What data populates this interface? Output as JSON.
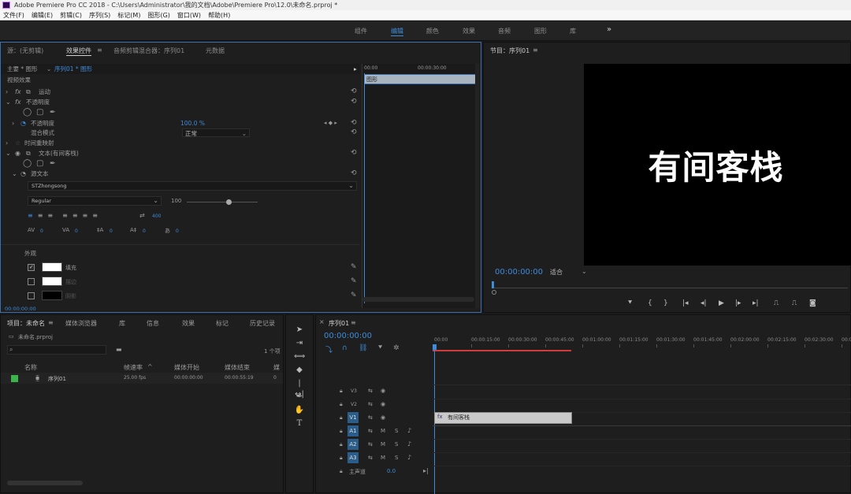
{
  "window": {
    "title": "Adobe Premiere Pro CC 2018 - C:\\Users\\Administrator\\我的文档\\Adobe\\Premiere Pro\\12.0\\未命名.prproj *"
  },
  "menu": [
    "文件(F)",
    "编辑(E)",
    "剪辑(C)",
    "序列(S)",
    "标记(M)",
    "图形(G)",
    "窗口(W)",
    "帮助(H)"
  ],
  "workspaces": [
    "组件",
    "编辑",
    "颜色",
    "效果",
    "音频",
    "图形",
    "库"
  ],
  "workspaces_more": "»",
  "effect_panel": {
    "tabs": [
      "源：(无剪辑)",
      "效果控件",
      "音频剪辑混合器：序列01",
      "元数据"
    ],
    "tab_menu": "≡",
    "master": "主要 * 图形",
    "seq": "序列01 * 图形",
    "section": "视频效果",
    "motion": "运动",
    "opacity": "不透明度",
    "opacity_prop": "不透明度",
    "opacity_value": "100.0 %",
    "blend_mode": "混合模式",
    "blend_value": "正常",
    "time_remap": "时间重映射",
    "text_layer": "文本(有间客栈)",
    "source_text": "源文本",
    "font": "STZhongsong",
    "style": "Regular",
    "font_size": "100",
    "tracking_icon_val": "400",
    "metrics": [
      "0",
      "0",
      "0",
      "0",
      "0"
    ],
    "appearance": "外观",
    "fill": "填充",
    "stroke": "描边",
    "shadow": "阴影",
    "timecode": "00:00:00:00",
    "mini_timeline": {
      "start": "00:00",
      "end": "00:00:30:00",
      "clip": "图形"
    }
  },
  "program": {
    "title": "节目：序列01",
    "tab_menu": "≡",
    "text": "有间客栈",
    "timecode": "00:00:00:00",
    "fit": "适合"
  },
  "project": {
    "tabs": [
      "项目：未命名",
      "媒体浏览器",
      "库",
      "信息",
      "效果",
      "标记",
      "历史记录"
    ],
    "tab_menu": "≡",
    "file": "未命名.prproj",
    "count": "1 个项",
    "columns": [
      "名称",
      "帧速率",
      "媒体开始",
      "媒体结束",
      "媒"
    ],
    "items": [
      {
        "name": "序列01",
        "fps": "25.00 fps",
        "start": "00:00:00:00",
        "end": "00:00:55:19",
        "more": "0"
      }
    ]
  },
  "timeline": {
    "title": "序列01",
    "tab_menu": "≡",
    "timecode": "00:00:00:00",
    "ruler": [
      "00:00",
      "00:00:15:00",
      "00:00:30:00",
      "00:00:45:00",
      "00:01:00:00",
      "00:01:15:00",
      "00:01:30:00",
      "00:01:45:00",
      "00:02:00:00",
      "00:02:15:00",
      "00:02:30:00",
      "00:02:45:00"
    ],
    "video_tracks": [
      "V3",
      "V2",
      "V1"
    ],
    "audio_tracks": [
      "A1",
      "A2",
      "A3"
    ],
    "master": "主声道",
    "master_val": "0.0",
    "clip": "有间客栈",
    "m_label": "M",
    "s_label": "S"
  },
  "colors": {
    "accent": "#3d8bd9",
    "fill": "#ffffff",
    "shadow": "#000000",
    "clip": "#c9c9c9",
    "playhead": "#d03b3b"
  }
}
